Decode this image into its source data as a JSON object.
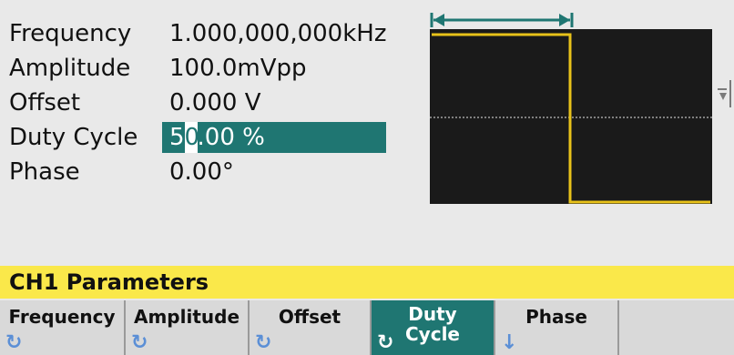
{
  "parameters": [
    {
      "label": "Frequency",
      "value": "1.000,000,000kHz"
    },
    {
      "label": "Amplitude",
      "value": "100.0mVpp"
    },
    {
      "label": "Offset",
      "value": "0.000 V"
    },
    {
      "label": "Duty Cycle",
      "value_prefix": "5",
      "value_cursor": "0",
      "value_suffix": ".00 %"
    },
    {
      "label": "Phase",
      "value": "0.00°"
    }
  ],
  "title_bar": "CH1  Parameters",
  "softkeys": [
    {
      "label": "Frequency",
      "icon": "rotary-knob-icon",
      "active": false
    },
    {
      "label": "Amplitude",
      "icon": "rotary-knob-icon",
      "active": false
    },
    {
      "label": "Offset",
      "icon": "rotary-knob-icon",
      "active": false
    },
    {
      "label_line1": "Duty",
      "label_line2": "Cycle",
      "icon": "rotary-knob-icon",
      "active": true
    },
    {
      "label": "Phase",
      "icon": "down-arrow-icon",
      "active": false
    }
  ],
  "colors": {
    "accent": "#1f7672",
    "title_bar": "#fae84a",
    "waveform": "#e8c21a",
    "marker": "#1f7672",
    "preview_bg": "#1a1a1a"
  },
  "waveform": {
    "type": "square",
    "duty_cycle_percent": 50
  }
}
